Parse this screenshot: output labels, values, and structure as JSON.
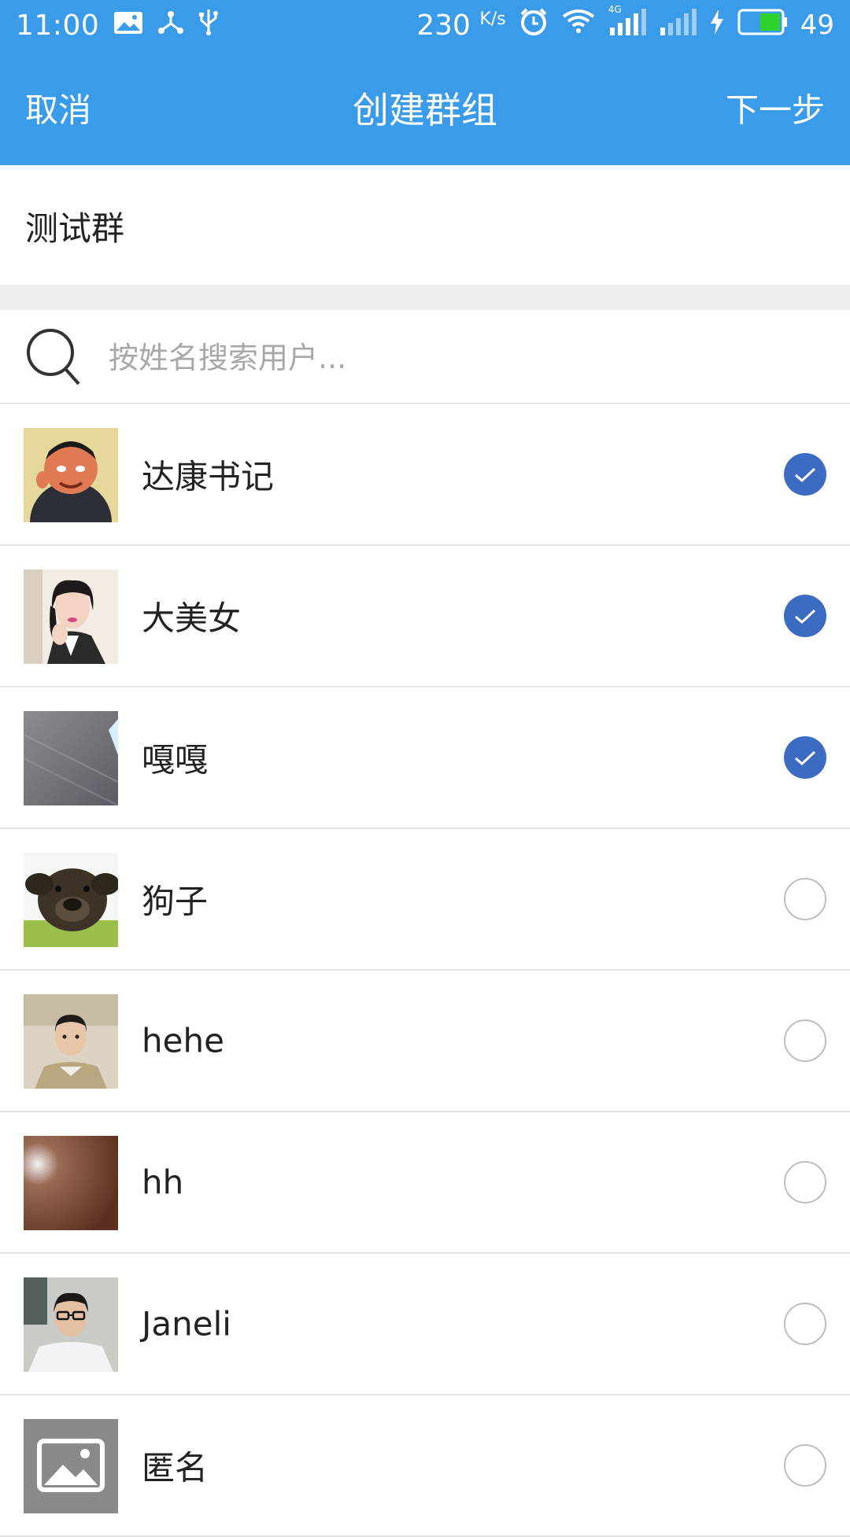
{
  "status_bar": {
    "time": "11:00",
    "speed": "230",
    "speed_unit": "K/s",
    "network": "4G",
    "battery": "49",
    "icons": [
      "image-icon",
      "usb-tree-icon",
      "usb-icon",
      "alarm-icon",
      "wifi-icon",
      "signal-icon",
      "signal-icon",
      "charging-icon",
      "battery-icon"
    ]
  },
  "header": {
    "cancel_label": "取消",
    "title": "创建群组",
    "next_label": "下一步"
  },
  "group_name": {
    "value": "测试群"
  },
  "search": {
    "placeholder": "按姓名搜索用户..."
  },
  "users": [
    {
      "name": "达康书记",
      "selected": true,
      "avatar": "cartoon-portrait"
    },
    {
      "name": "大美女",
      "selected": true,
      "avatar": "woman-portrait"
    },
    {
      "name": "嘎嘎",
      "selected": true,
      "avatar": "gray-photo"
    },
    {
      "name": "狗子",
      "selected": false,
      "avatar": "dog-photo"
    },
    {
      "name": "hehe",
      "selected": false,
      "avatar": "man-portrait"
    },
    {
      "name": "hh",
      "selected": false,
      "avatar": "brown-photo"
    },
    {
      "name": "Janeli",
      "selected": false,
      "avatar": "glasses-man-portrait"
    },
    {
      "name": "匿名",
      "selected": false,
      "avatar": "placeholder-image"
    }
  ],
  "colors": {
    "accent": "#3a9be8",
    "check_selected": "#3c6bc2",
    "separator": "#efefef"
  }
}
